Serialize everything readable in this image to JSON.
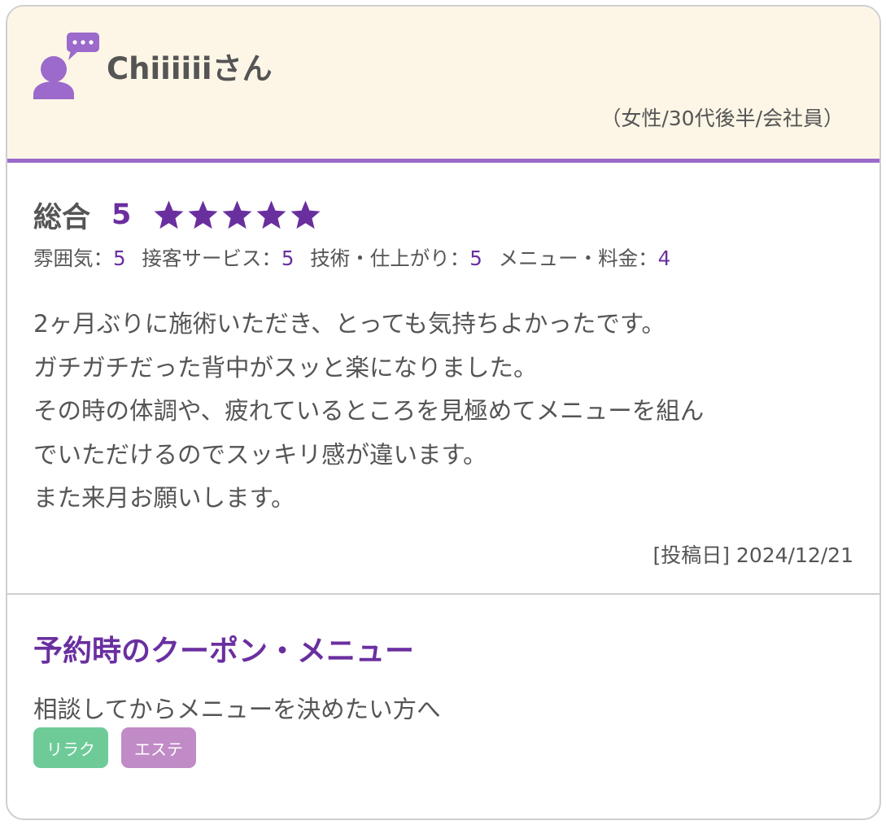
{
  "reviewer": {
    "name": "Chiiiiiiさん",
    "profile": "（女性/30代後半/会社員）"
  },
  "overall": {
    "label": "総合",
    "score": "5",
    "stars": 5,
    "max_stars": 5,
    "star_color": "#6a2f9f"
  },
  "ratings": [
    {
      "label": "雰囲気：",
      "value": "5"
    },
    {
      "label": "接客サービス：",
      "value": "5"
    },
    {
      "label": "技術・仕上がり：",
      "value": "5"
    },
    {
      "label": "メニュー・料金：",
      "value": "4"
    }
  ],
  "comment": {
    "lines": [
      "2ヶ月ぶりに施術いただき、とっても気持ちよかったです。",
      "ガチガチだった背中がスッと楽になりました。",
      "その時の体調や、疲れているところを見極めてメニューを組ん",
      "でいただけるのでスッキリ感が違います。",
      "また来月お願いします。"
    ]
  },
  "post_date": "[投稿日] 2024/12/21",
  "coupon": {
    "title": "予約時のクーポン・メニュー",
    "description": "相談してからメニューを決めたい方へ",
    "tags": [
      {
        "label": "リラク",
        "color": "#6ecb98"
      },
      {
        "label": "エステ",
        "color": "#c08bc6"
      }
    ]
  },
  "colors": {
    "accent_purple": "#6a2f9f",
    "header_bg": "#fdf6e7",
    "header_border": "#9b6acb",
    "avatar": "#9b6acb"
  },
  "icons": {
    "avatar": "user-speech-bubble-icon",
    "star": "star-icon"
  }
}
